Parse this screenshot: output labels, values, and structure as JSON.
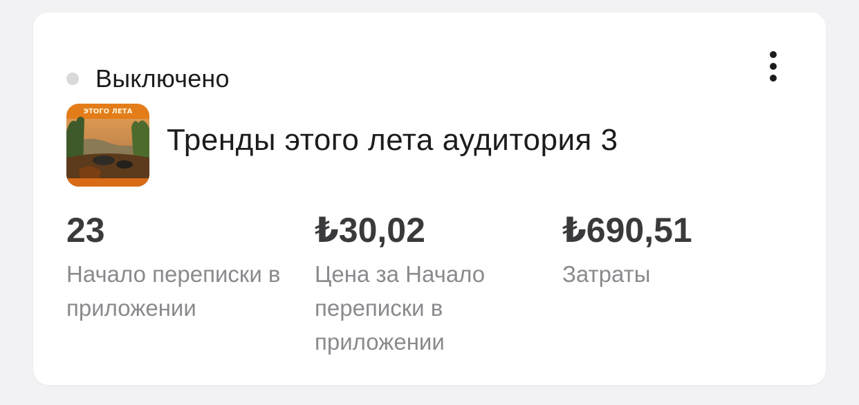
{
  "status": {
    "label": "Выключено",
    "dot_color": "#d9d9db"
  },
  "menu": {
    "icon": "more-vertical-icon"
  },
  "ad": {
    "title": "Тренды этого лета аудитория 3",
    "thumbnail_caption": "ЭТОГО ЛЕТА"
  },
  "metrics": [
    {
      "value": "23",
      "label": "Начало переписки в приложении"
    },
    {
      "value": "₺30,02",
      "label": "Цена за Начало переписки в приложении"
    },
    {
      "value": "₺690,51",
      "label": "Затраты"
    }
  ]
}
